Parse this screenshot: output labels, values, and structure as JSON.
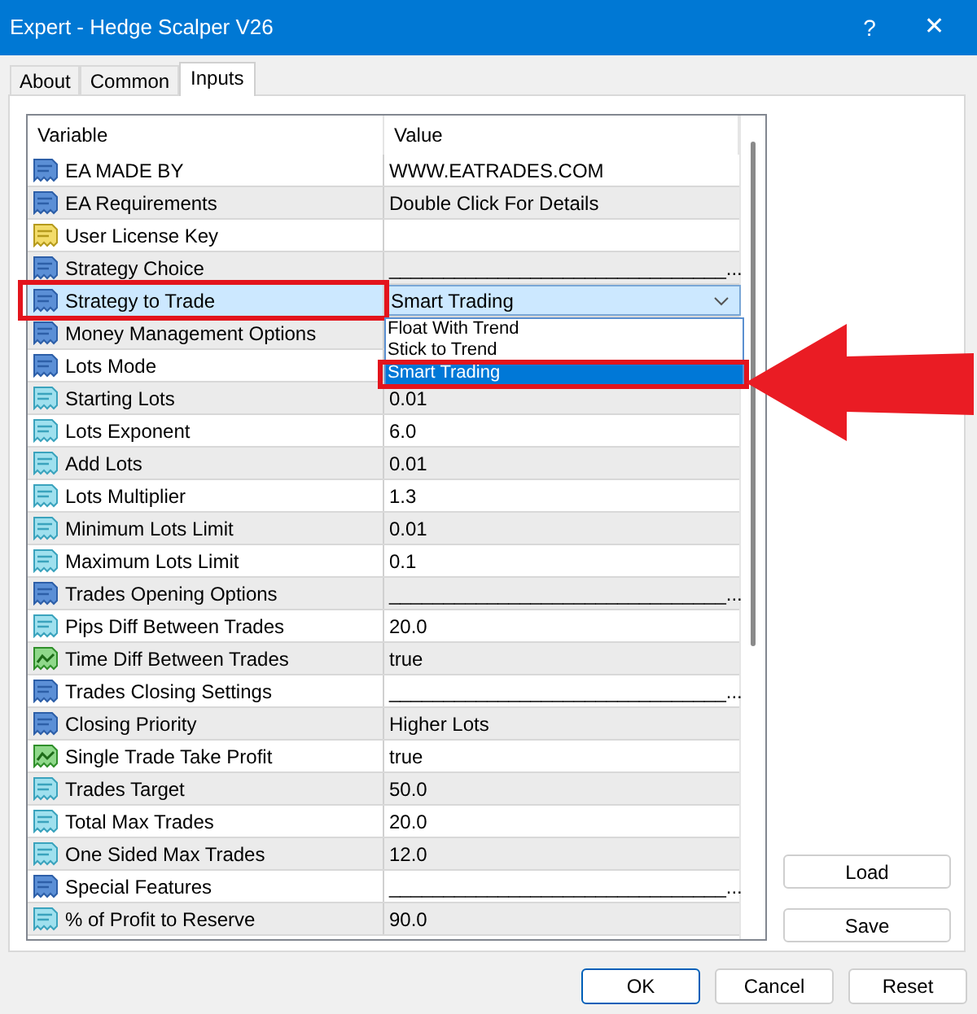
{
  "window": {
    "title": "Expert - Hedge Scalper V26",
    "help": "?",
    "close": "✕"
  },
  "tabs": [
    {
      "label": "About",
      "selected": false
    },
    {
      "label": "Common",
      "selected": false
    },
    {
      "label": "Inputs",
      "selected": true
    }
  ],
  "table": {
    "columns": [
      "Variable",
      "Value"
    ],
    "rows": [
      {
        "kind": "int",
        "variable": "EA MADE BY",
        "value": "WWW.EATRADES.COM",
        "selected": false
      },
      {
        "kind": "int",
        "variable": "EA Requirements",
        "value": "Double Click For Details",
        "selected": false
      },
      {
        "kind": "string",
        "variable": "User License Key",
        "selected": false
      },
      {
        "kind": "int",
        "variable": "Strategy Choice",
        "value": "_______________________________...",
        "selected": false
      },
      {
        "kind": "int",
        "variable": "Strategy to Trade",
        "value": "Smart Trading",
        "selected": true,
        "highlighted": true,
        "dropdown": {
          "options": [
            {
              "label": "Float With Trend",
              "selected": false
            },
            {
              "label": "Stick to Trend",
              "selected": false
            },
            {
              "label": "Smart Trading",
              "selected": true
            }
          ]
        }
      },
      {
        "kind": "int",
        "variable": "Money Management Options",
        "selected": false
      },
      {
        "kind": "int",
        "variable": "Lots Mode",
        "selected": false
      },
      {
        "kind": "double",
        "variable": "Starting Lots",
        "value": "0.01",
        "selected": false
      },
      {
        "kind": "double",
        "variable": "Lots Exponent",
        "value": "6.0",
        "selected": false
      },
      {
        "kind": "double",
        "variable": "Add Lots",
        "value": "0.01",
        "selected": false
      },
      {
        "kind": "double",
        "variable": "Lots Multiplier",
        "value": "1.3",
        "selected": false
      },
      {
        "kind": "double",
        "variable": "Minimum Lots Limit",
        "value": "0.01",
        "selected": false
      },
      {
        "kind": "double",
        "variable": "Maximum Lots Limit",
        "value": "0.1",
        "selected": false
      },
      {
        "kind": "int",
        "variable": "Trades Opening Options",
        "value": "_______________________________...",
        "selected": false
      },
      {
        "kind": "double",
        "variable": "Pips Diff Between Trades",
        "value": "20.0",
        "selected": false
      },
      {
        "kind": "bool",
        "variable": "Time Diff Between Trades",
        "value": "true",
        "selected": false
      },
      {
        "kind": "int",
        "variable": "Trades Closing Settings",
        "value": "_______________________________...",
        "selected": false
      },
      {
        "kind": "int",
        "variable": "Closing Priority",
        "value": "Higher Lots",
        "selected": false
      },
      {
        "kind": "bool",
        "variable": "Single Trade Take Profit",
        "value": "true",
        "selected": false
      },
      {
        "kind": "double",
        "variable": "Trades Target",
        "value": "50.0",
        "selected": false
      },
      {
        "kind": "double",
        "variable": "Total Max Trades",
        "value": "20.0",
        "selected": false
      },
      {
        "kind": "double",
        "variable": "One Sided Max Trades",
        "value": "12.0",
        "selected": false
      },
      {
        "kind": "int",
        "variable": "Special Features",
        "value": "_______________________________...",
        "selected": false
      },
      {
        "kind": "double",
        "variable": "% of Profit to Reserve",
        "value": "90.0",
        "selected": false
      }
    ]
  },
  "side_buttons": [
    "Load",
    "Save"
  ],
  "buttons": [
    {
      "label": "OK",
      "default": true
    },
    {
      "label": "Cancel",
      "default": false
    },
    {
      "label": "Reset",
      "default": false
    }
  ]
}
